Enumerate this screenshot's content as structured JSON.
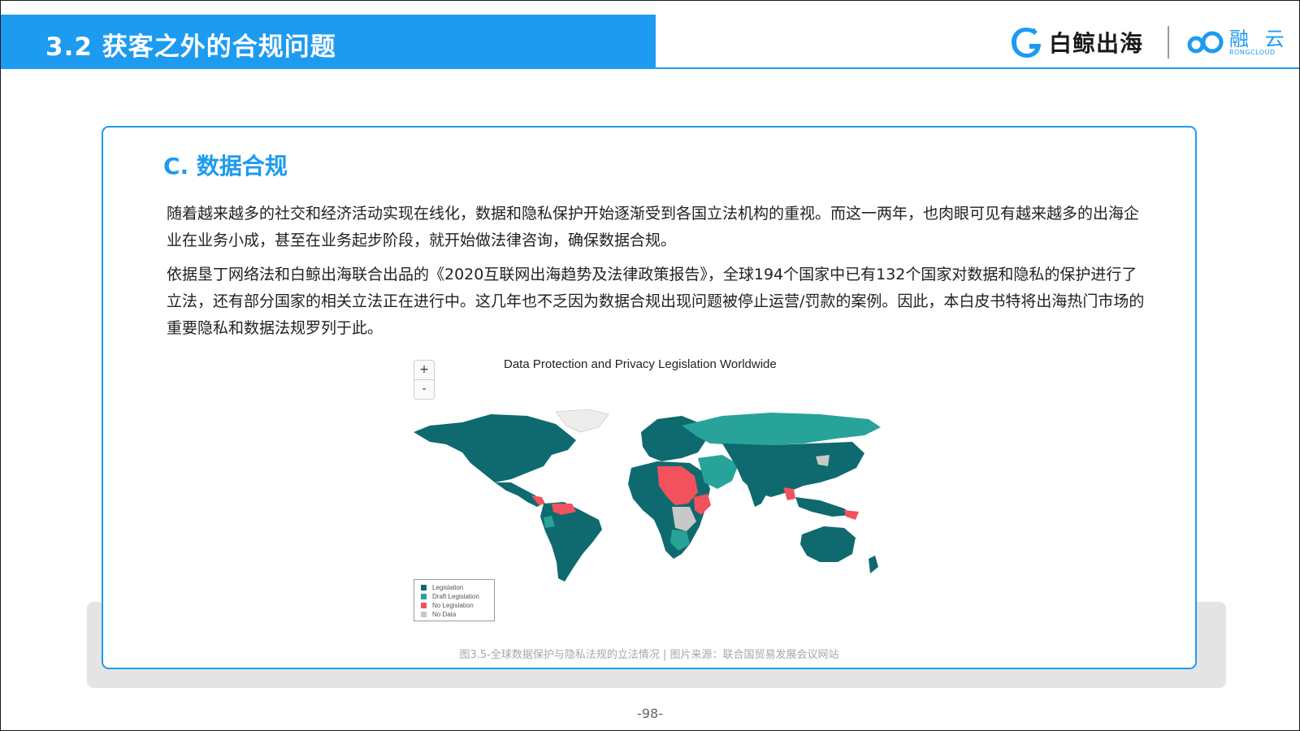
{
  "header": {
    "title": "3.2 获客之外的合规问题",
    "logo_baijing": "白鲸出海",
    "logo_rongyun_cn": "融 云",
    "logo_rongyun_en": "RONGCLOUD"
  },
  "colors": {
    "brand_blue": "#1d9bf0",
    "legislation": "#0e6a6e",
    "draft_legislation": "#27a39a",
    "no_legislation": "#f2515e",
    "no_data": "#c8c8c8"
  },
  "section": {
    "title": "C. 数据合规",
    "paragraphs": [
      "随着越来越多的社交和经济活动实现在线化，数据和隐私保护开始逐渐受到各国立法机构的重视。而这一两年，也肉眼可见有越来越多的出海企业在业务小成，甚至在业务起步阶段，就开始做法律咨询，确保数据合规。",
      "依据垦丁网络法和白鲸出海联合出品的《2020互联网出海趋势及法律政策报告》，全球194个国家中已有132个国家对数据和隐私的保护进行了立法，还有部分国家的相关立法正在进行中。这几年也不乏因为数据合规出现问题被停止运营/罚款的案例。因此，本白皮书特将出海热门市场的重要隐私和数据法规罗列于此。"
    ]
  },
  "map": {
    "title": "Data Protection and Privacy Legislation Worldwide",
    "zoom_in": "+",
    "zoom_out": "-",
    "legend": [
      "Legislation",
      "Draft Legislation",
      "No Legislation",
      "No Data"
    ]
  },
  "caption": "图3.5-全球数据保护与隐私法规的立法情况 | 图片来源：联合国贸易发展会议网站",
  "page_number": "-98-"
}
